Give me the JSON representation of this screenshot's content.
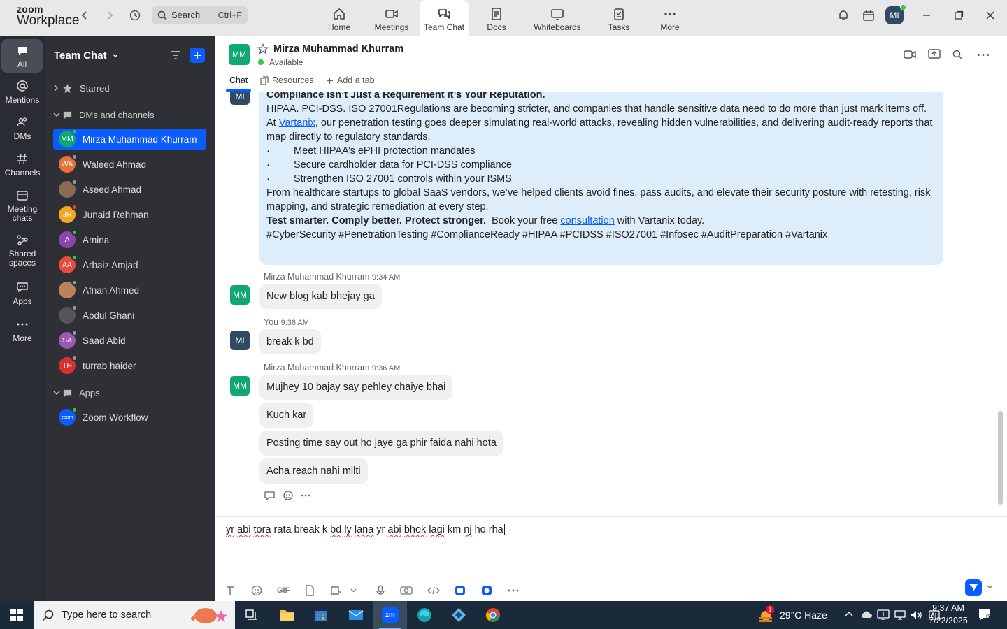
{
  "app": {
    "brand_top": "zoom",
    "brand_bottom": "Workplace"
  },
  "search": {
    "placeholder": "Search",
    "shortcut": "Ctrl+F"
  },
  "nav": [
    {
      "label": "Home",
      "icon": "home-icon"
    },
    {
      "label": "Meetings",
      "icon": "video-icon"
    },
    {
      "label": "Team Chat",
      "icon": "chat-icon"
    },
    {
      "label": "Docs",
      "icon": "docs-icon"
    },
    {
      "label": "Whiteboards",
      "icon": "whiteboard-icon"
    },
    {
      "label": "Tasks",
      "icon": "tasks-icon"
    },
    {
      "label": "More",
      "icon": "more-icon"
    }
  ],
  "user_avatar": "MI",
  "rail": [
    {
      "label": "All",
      "icon": "chat-bubble-icon"
    },
    {
      "label": "Mentions",
      "icon": "at-icon"
    },
    {
      "label": "DMs",
      "icon": "people-icon"
    },
    {
      "label": "Channels",
      "icon": "hash-icon"
    },
    {
      "label": "Meeting chats",
      "icon": "calendar-icon"
    },
    {
      "label": "Shared spaces",
      "icon": "share-icon"
    },
    {
      "label": "Apps",
      "icon": "apps-icon"
    },
    {
      "label": "More",
      "icon": "more-icon"
    }
  ],
  "sidebar": {
    "title": "Team Chat",
    "starred": "Starred",
    "dms_header": "DMs and channels",
    "apps_header": "Apps",
    "contacts": [
      {
        "initials": "MM",
        "name": "Mirza Muhammad Khurram",
        "color": "#0fa870",
        "status": "#2ecc40"
      },
      {
        "initials": "WA",
        "name": "Waleed Ahmad",
        "color": "#e8713a",
        "status": "#9a9a9a"
      },
      {
        "initials": "",
        "name": "Aseed Ahmad",
        "color": "#8a6a50",
        "status": "#9a9a9a"
      },
      {
        "initials": "JR",
        "name": "Junaid Rehman",
        "color": "#f5a623",
        "status": "#e83e3e"
      },
      {
        "initials": "A",
        "name": "Amina",
        "color": "#8e44ad",
        "status": "#2ecc40"
      },
      {
        "initials": "AA",
        "name": "Arbaiz Amjad",
        "color": "#e74c3c",
        "status": "#2ecc40"
      },
      {
        "initials": "",
        "name": "Afnan Ahmed",
        "color": "#b9845a",
        "status": "#9a9a9a"
      },
      {
        "initials": "",
        "name": "Abdul Ghani",
        "color": "#555555",
        "status": "#9a9a9a"
      },
      {
        "initials": "SA",
        "name": "Saad Abid",
        "color": "#9b59b6",
        "status": "#9a9a9a"
      },
      {
        "initials": "TH",
        "name": "turrab haider",
        "color": "#d63031",
        "status": "#9a9a9a"
      }
    ],
    "app_item": {
      "name": "Zoom Workflow",
      "icon_text": "zoom"
    }
  },
  "chat": {
    "contact_initials": "MM",
    "contact_name": "Mirza Muhammad Khurram",
    "status": "Available",
    "tabs": {
      "chat": "Chat",
      "resources": "Resources",
      "add": "Add a tab"
    }
  },
  "big_message": {
    "heading": "Compliance Isn’t Just a Requirement It’s Your Reputation.",
    "p1": "HIPAA. PCI-DSS. ISO 27001Regulations are becoming stricter, and companies that handle sensitive data need to do more than just mark items off.",
    "p2_pre": "At ",
    "p2_link": "Vartanix",
    "p2_post": ", our penetration testing goes deeper simulating real-world attacks, revealing hidden vulnerabilities, and delivering audit-ready reports that map directly to regulatory standards.",
    "bullets": [
      "Meet HIPAA’s ePHI protection mandates",
      "Secure cardholder data for PCI-DSS compliance",
      "Strengthen ISO 27001 controls within your ISMS"
    ],
    "bullet_char": "·",
    "p3": "From healthcare startups to global SaaS vendors, we’ve helped clients avoid fines, pass audits, and elevate their security posture with retesting, risk mapping, and strategic remediation at every step.",
    "p4_bold": "Test smarter. Comply better. Protect stronger.",
    "p4_pre": "Book your free ",
    "p4_link": "consultation",
    "p4_post": " with Vartanix today.",
    "tags": "#CyberSecurity #PenetrationTesting #ComplianceReady #HIPAA #PCIDSS #ISO27001 #Infosec #AuditPreparation #Vartanix",
    "sender_initials": "MI"
  },
  "messages": {
    "m1": {
      "sender": "Mirza Muhammad Khurram",
      "time": "9:34 AM",
      "initials": "MM",
      "texts": [
        "New blog kab bhejay ga"
      ]
    },
    "m2": {
      "sender": "You",
      "time": "9:36 AM",
      "initials": "MI",
      "texts": [
        "break k bd"
      ]
    },
    "m3": {
      "sender": "Mirza Muhammad Khurram",
      "time": "9:36 AM",
      "initials": "MM",
      "texts": [
        "Mujhey 10 bajay say pehley chaiye bhai",
        "Kuch kar",
        "Posting time say out ho jaye ga phir faida nahi hota",
        "Acha reach nahi milti"
      ]
    }
  },
  "composer": {
    "w1": "yr",
    "w2": "abi",
    "w3": "tora",
    "w4": "rata break k",
    "w5": "bd",
    "w6": "ly",
    "w7": "lana",
    "w8": "yr",
    "w9": "abi",
    "w10": "bhok",
    "w11": "lagi",
    "w12": "km",
    "w13": "nj",
    "w14": "ho rha",
    "gif_label": "GIF"
  },
  "taskbar": {
    "search_placeholder": "Type here to search",
    "weather": "29°C  Haze",
    "weather_badge": "1",
    "time": "9:37 AM",
    "date": "7/22/2025",
    "notif_count": "6",
    "zoom_label": "zm"
  }
}
